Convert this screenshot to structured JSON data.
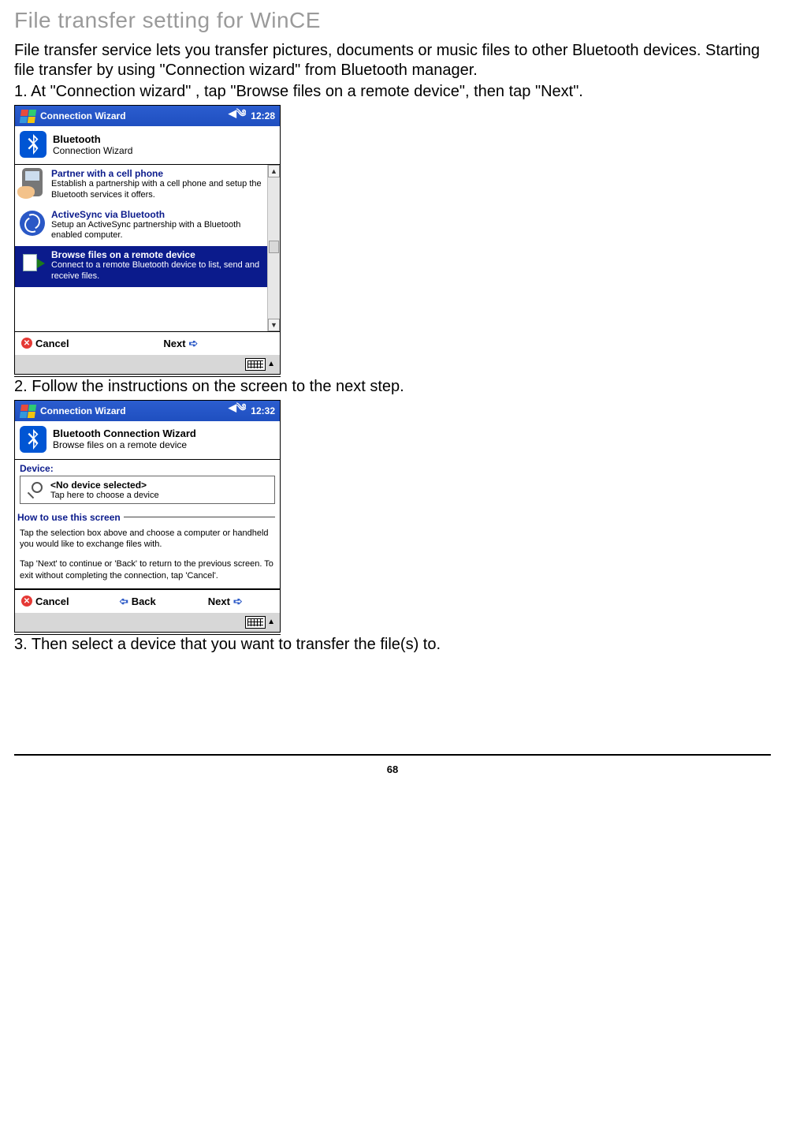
{
  "page": {
    "title": "File transfer setting for WinCE",
    "intro": "File transfer service lets you transfer pictures, documents or music files to other Bluetooth devices. Starting file transfer by using \"Connection wizard\" from Bluetooth manager.",
    "step1": "1. At \"Connection wizard\" , tap \"Browse files on a remote device\", then tap \"Next\".",
    "step2": "2. Follow the instructions on the screen to the next step.",
    "step3": "3. Then select a device that you want to transfer the file(s) to.",
    "number": "68"
  },
  "screenshot1": {
    "titlebar": {
      "title": "Connection Wizard",
      "time": "12:28"
    },
    "header": {
      "title": "Bluetooth",
      "subtitle": "Connection Wizard"
    },
    "items": [
      {
        "title": "Partner with a cell phone",
        "desc": "Establish a partnership with a cell phone and setup the Bluetooth services it offers."
      },
      {
        "title": "ActiveSync via Bluetooth",
        "desc": "Setup an ActiveSync partnership with a Bluetooth enabled computer."
      },
      {
        "title": "Browse files on a remote device",
        "desc": "Connect to a remote Bluetooth device to list, send and receive files."
      }
    ],
    "footer": {
      "cancel": "Cancel",
      "next": "Next"
    }
  },
  "screenshot2": {
    "titlebar": {
      "title": "Connection Wizard",
      "time": "12:32"
    },
    "header": {
      "title": "Bluetooth Connection Wizard",
      "subtitle": "Browse files on a remote device"
    },
    "deviceLabel": "Device:",
    "device": {
      "title": "<No device selected>",
      "desc": "Tap here to choose a device"
    },
    "howtoLegend": "How to use this screen",
    "howto1": "Tap the selection box above and choose a computer or handheld you would like to exchange files with.",
    "howto2": "Tap 'Next' to continue or 'Back' to return to the previous screen. To exit without completing the connection, tap 'Cancel'.",
    "footer": {
      "cancel": "Cancel",
      "back": "Back",
      "next": "Next"
    }
  }
}
